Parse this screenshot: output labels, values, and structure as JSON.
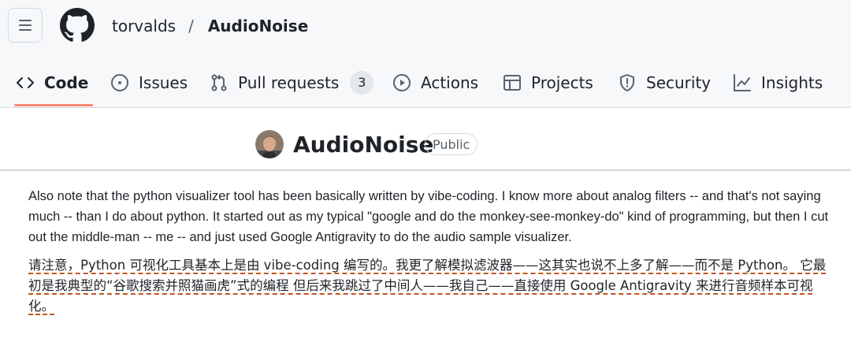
{
  "header": {
    "owner": "torvalds",
    "separator": "/",
    "repo": "AudioNoise"
  },
  "tabs": [
    {
      "label": "Code",
      "icon": "code-icon",
      "active": true
    },
    {
      "label": "Issues",
      "icon": "issue-opened-icon"
    },
    {
      "label": "Pull requests",
      "icon": "git-pull-request-icon",
      "count": "3"
    },
    {
      "label": "Actions",
      "icon": "play-icon"
    },
    {
      "label": "Projects",
      "icon": "table-icon"
    },
    {
      "label": "Security",
      "icon": "shield-icon"
    },
    {
      "label": "Insights",
      "icon": "graph-icon"
    }
  ],
  "repo_header": {
    "title": "AudioNoise",
    "visibility": "Public"
  },
  "body": {
    "english": "Also note that the python visualizer tool has been basically written by vibe-coding. I know more about analog filters -- and that's not saying much -- than I do about python. It started out as my typical \"google and do the monkey-see-monkey-do\" kind of programming, but then I cut out the middle-man -- me -- and just used Google Antigravity to do the audio sample visualizer.",
    "chinese": "请注意，Python 可视化工具基本上是由 vibe-coding 编写的。我更了解模拟滤波器——这其实也说不上多了解——而不是 Python。 它最初是我典型的“谷歌搜索并照猫画虎”式的编程 但后来我跳过了中间人——我自己——直接使用 Google Antigravity 来进行音频样本可视化。"
  },
  "colors": {
    "header_bg": "#f6f8fa",
    "active_tab_underline": "#fd8c73",
    "translation_underline": "#c0561e"
  }
}
